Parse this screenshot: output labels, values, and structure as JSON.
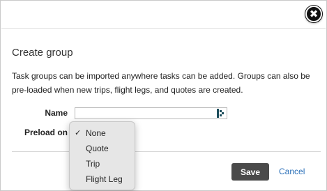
{
  "dialog": {
    "close_glyph": "✖",
    "title": "Create group",
    "description": "Task groups can be imported anywhere tasks can be added. Groups can also be pre-loaded when new trips, flight legs, and quotes are created."
  },
  "form": {
    "name_label": "Name",
    "name_value": "",
    "preload_label": "Preload on",
    "preload_selected": "None"
  },
  "dropdown": {
    "check_glyph": "✓",
    "options": [
      "None",
      "Quote",
      "Trip",
      "Flight Leg"
    ]
  },
  "footer": {
    "save_label": "Save",
    "cancel_label": "Cancel"
  },
  "colors": {
    "save_bg": "#4a4a4a",
    "link": "#2a6fb8",
    "input_icon": "#1d4e5c"
  },
  "icons": {
    "close": "close-icon",
    "input_helper": "list-lookup-icon",
    "selected": "checkmark-icon"
  }
}
